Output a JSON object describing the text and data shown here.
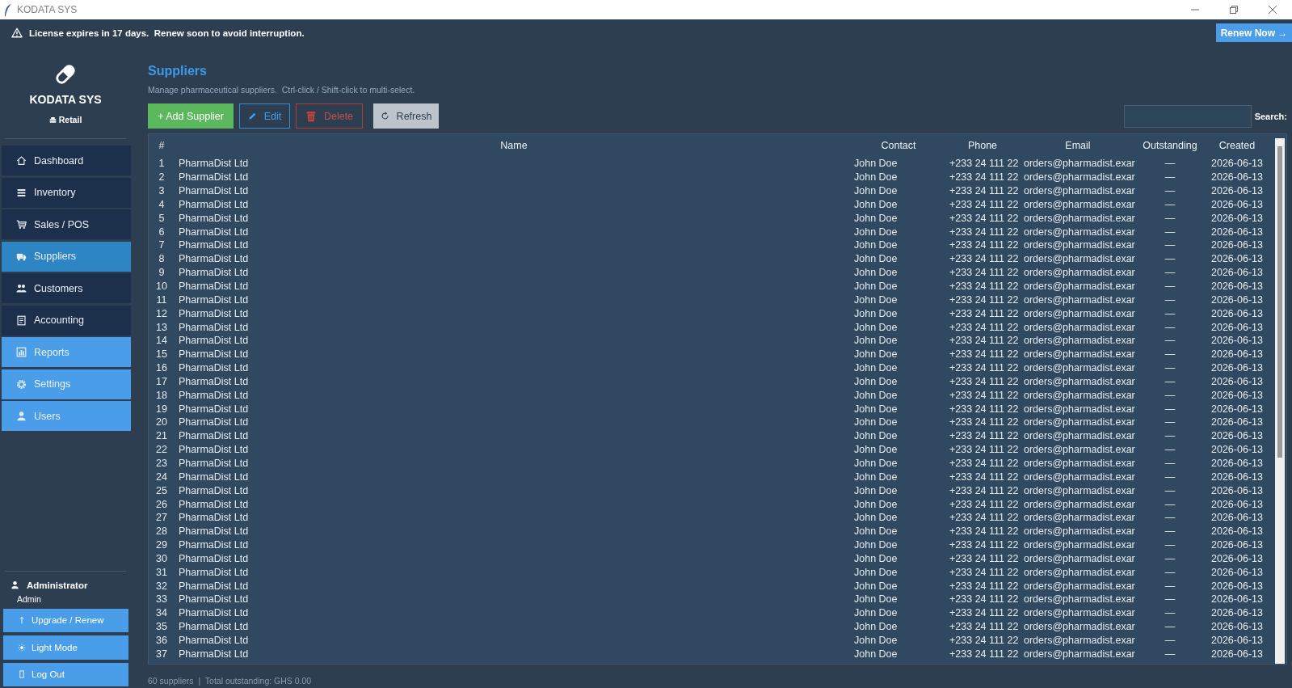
{
  "window": {
    "title": "KODATA SYS"
  },
  "banner": {
    "message": "License expires in 17 days.  Renew soon to avoid interruption.",
    "action": "Renew Now →"
  },
  "sidebar": {
    "brand": "KODATA SYS",
    "edition": "Retail",
    "items": [
      {
        "label": "Dashboard",
        "kind": "standard",
        "selected": false
      },
      {
        "label": "Inventory",
        "kind": "standard",
        "selected": false
      },
      {
        "label": "Sales / POS",
        "kind": "standard",
        "selected": false
      },
      {
        "label": "Suppliers",
        "kind": "standard",
        "selected": true
      },
      {
        "label": "Customers",
        "kind": "standard",
        "selected": false
      },
      {
        "label": "Accounting",
        "kind": "standard",
        "selected": false
      },
      {
        "label": "Reports",
        "kind": "accent",
        "selected": false
      },
      {
        "label": "Settings",
        "kind": "accent",
        "selected": false
      },
      {
        "label": "Users",
        "kind": "accent",
        "selected": false
      }
    ],
    "user": {
      "name": "Administrator",
      "role": "Admin"
    },
    "buttons": [
      {
        "label": "Upgrade / Renew"
      },
      {
        "label": "Light Mode"
      },
      {
        "label": "Log Out"
      }
    ]
  },
  "page": {
    "title": "Suppliers",
    "subtitle": "Manage pharmaceutical suppliers.  Ctrl-click / Shift-click to multi-select."
  },
  "toolbar": {
    "buttons": [
      {
        "label": "+ Add Supplier",
        "kind": "add"
      },
      {
        "label": "Edit",
        "kind": "edit"
      },
      {
        "label": "Delete",
        "kind": "delete"
      },
      {
        "label": "Refresh",
        "kind": "refresh"
      }
    ],
    "search": {
      "label": "Search:"
    }
  },
  "table": {
    "columns": [
      "#",
      "Name",
      "Contact",
      "Phone",
      "Email",
      "Outstanding",
      "Created"
    ],
    "rows": [
      [
        "1",
        "PharmaDist Ltd",
        "John Doe",
        "+233 24 111 22",
        "orders@pharmadist.exar",
        "—",
        "2026-06-13"
      ],
      [
        "2",
        "PharmaDist Ltd",
        "John Doe",
        "+233 24 111 22",
        "orders@pharmadist.exar",
        "—",
        "2026-06-13"
      ],
      [
        "3",
        "PharmaDist Ltd",
        "John Doe",
        "+233 24 111 22",
        "orders@pharmadist.exar",
        "—",
        "2026-06-13"
      ],
      [
        "4",
        "PharmaDist Ltd",
        "John Doe",
        "+233 24 111 22",
        "orders@pharmadist.exar",
        "—",
        "2026-06-13"
      ],
      [
        "5",
        "PharmaDist Ltd",
        "John Doe",
        "+233 24 111 22",
        "orders@pharmadist.exar",
        "—",
        "2026-06-13"
      ],
      [
        "6",
        "PharmaDist Ltd",
        "John Doe",
        "+233 24 111 22",
        "orders@pharmadist.exar",
        "—",
        "2026-06-13"
      ],
      [
        "7",
        "PharmaDist Ltd",
        "John Doe",
        "+233 24 111 22",
        "orders@pharmadist.exar",
        "—",
        "2026-06-13"
      ],
      [
        "8",
        "PharmaDist Ltd",
        "John Doe",
        "+233 24 111 22",
        "orders@pharmadist.exar",
        "—",
        "2026-06-13"
      ],
      [
        "9",
        "PharmaDist Ltd",
        "John Doe",
        "+233 24 111 22",
        "orders@pharmadist.exar",
        "—",
        "2026-06-13"
      ],
      [
        "10",
        "PharmaDist Ltd",
        "John Doe",
        "+233 24 111 22",
        "orders@pharmadist.exar",
        "—",
        "2026-06-13"
      ],
      [
        "11",
        "PharmaDist Ltd",
        "John Doe",
        "+233 24 111 22",
        "orders@pharmadist.exar",
        "—",
        "2026-06-13"
      ],
      [
        "12",
        "PharmaDist Ltd",
        "John Doe",
        "+233 24 111 22",
        "orders@pharmadist.exar",
        "—",
        "2026-06-13"
      ],
      [
        "13",
        "PharmaDist Ltd",
        "John Doe",
        "+233 24 111 22",
        "orders@pharmadist.exar",
        "—",
        "2026-06-13"
      ],
      [
        "14",
        "PharmaDist Ltd",
        "John Doe",
        "+233 24 111 22",
        "orders@pharmadist.exar",
        "—",
        "2026-06-13"
      ],
      [
        "15",
        "PharmaDist Ltd",
        "John Doe",
        "+233 24 111 22",
        "orders@pharmadist.exar",
        "—",
        "2026-06-13"
      ],
      [
        "16",
        "PharmaDist Ltd",
        "John Doe",
        "+233 24 111 22",
        "orders@pharmadist.exar",
        "—",
        "2026-06-13"
      ],
      [
        "17",
        "PharmaDist Ltd",
        "John Doe",
        "+233 24 111 22",
        "orders@pharmadist.exar",
        "—",
        "2026-06-13"
      ],
      [
        "18",
        "PharmaDist Ltd",
        "John Doe",
        "+233 24 111 22",
        "orders@pharmadist.exar",
        "—",
        "2026-06-13"
      ],
      [
        "19",
        "PharmaDist Ltd",
        "John Doe",
        "+233 24 111 22",
        "orders@pharmadist.exar",
        "—",
        "2026-06-13"
      ],
      [
        "20",
        "PharmaDist Ltd",
        "John Doe",
        "+233 24 111 22",
        "orders@pharmadist.exar",
        "—",
        "2026-06-13"
      ],
      [
        "21",
        "PharmaDist Ltd",
        "John Doe",
        "+233 24 111 22",
        "orders@pharmadist.exar",
        "—",
        "2026-06-13"
      ],
      [
        "22",
        "PharmaDist Ltd",
        "John Doe",
        "+233 24 111 22",
        "orders@pharmadist.exar",
        "—",
        "2026-06-13"
      ],
      [
        "23",
        "PharmaDist Ltd",
        "John Doe",
        "+233 24 111 22",
        "orders@pharmadist.exar",
        "—",
        "2026-06-13"
      ],
      [
        "24",
        "PharmaDist Ltd",
        "John Doe",
        "+233 24 111 22",
        "orders@pharmadist.exar",
        "—",
        "2026-06-13"
      ],
      [
        "25",
        "PharmaDist Ltd",
        "John Doe",
        "+233 24 111 22",
        "orders@pharmadist.exar",
        "—",
        "2026-06-13"
      ],
      [
        "26",
        "PharmaDist Ltd",
        "John Doe",
        "+233 24 111 22",
        "orders@pharmadist.exar",
        "—",
        "2026-06-13"
      ],
      [
        "27",
        "PharmaDist Ltd",
        "John Doe",
        "+233 24 111 22",
        "orders@pharmadist.exar",
        "—",
        "2026-06-13"
      ],
      [
        "28",
        "PharmaDist Ltd",
        "John Doe",
        "+233 24 111 22",
        "orders@pharmadist.exar",
        "—",
        "2026-06-13"
      ],
      [
        "29",
        "PharmaDist Ltd",
        "John Doe",
        "+233 24 111 22",
        "orders@pharmadist.exar",
        "—",
        "2026-06-13"
      ],
      [
        "30",
        "PharmaDist Ltd",
        "John Doe",
        "+233 24 111 22",
        "orders@pharmadist.exar",
        "—",
        "2026-06-13"
      ],
      [
        "31",
        "PharmaDist Ltd",
        "John Doe",
        "+233 24 111 22",
        "orders@pharmadist.exar",
        "—",
        "2026-06-13"
      ],
      [
        "32",
        "PharmaDist Ltd",
        "John Doe",
        "+233 24 111 22",
        "orders@pharmadist.exar",
        "—",
        "2026-06-13"
      ],
      [
        "33",
        "PharmaDist Ltd",
        "John Doe",
        "+233 24 111 22",
        "orders@pharmadist.exar",
        "—",
        "2026-06-13"
      ],
      [
        "34",
        "PharmaDist Ltd",
        "John Doe",
        "+233 24 111 22",
        "orders@pharmadist.exar",
        "—",
        "2026-06-13"
      ],
      [
        "35",
        "PharmaDist Ltd",
        "John Doe",
        "+233 24 111 22",
        "orders@pharmadist.exar",
        "—",
        "2026-06-13"
      ],
      [
        "36",
        "PharmaDist Ltd",
        "John Doe",
        "+233 24 111 22",
        "orders@pharmadist.exar",
        "—",
        "2026-06-13"
      ],
      [
        "37",
        "PharmaDist Ltd",
        "John Doe",
        "+233 24 111 22",
        "orders@pharmadist.exar",
        "—",
        "2026-06-13"
      ]
    ]
  },
  "status_bar": {
    "text": "60 suppliers  |  Total outstanding: GHS 0.00"
  }
}
